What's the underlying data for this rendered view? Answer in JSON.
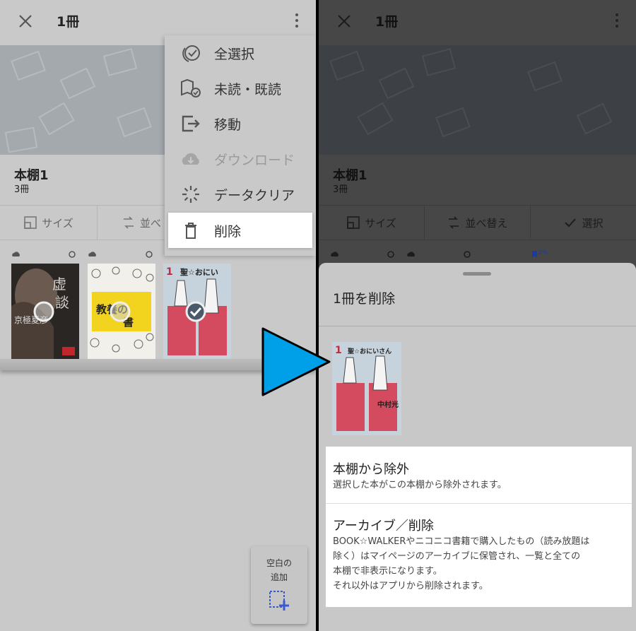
{
  "left": {
    "header": {
      "title": "1冊"
    },
    "shelf": {
      "name": "本棚1",
      "count": "3冊"
    },
    "toolbar": {
      "size_label": "サイズ",
      "sort_label": "並べ"
    },
    "menu": {
      "items": [
        {
          "label": "全選択",
          "icon": "select-all-icon"
        },
        {
          "label": "未読・既読",
          "icon": "read-status-icon"
        },
        {
          "label": "移動",
          "icon": "move-icon"
        },
        {
          "label": "ダウンロード",
          "icon": "cloud-download-icon",
          "disabled": true
        },
        {
          "label": "データクリア",
          "icon": "data-clear-icon"
        },
        {
          "label": "削除",
          "icon": "trash-icon",
          "highlighted": true
        }
      ]
    },
    "books": [
      {
        "cover_text_top": "虚談",
        "cover_text_bottom": "京極夏彦",
        "selected": false
      },
      {
        "cover_text_top": "教養の教科書",
        "selected": false
      },
      {
        "cover_text_top": "聖☆おにいさん",
        "selected": true
      }
    ],
    "add_blank": {
      "label": "空白の\n追加"
    }
  },
  "right": {
    "header": {
      "title": "1冊"
    },
    "shelf": {
      "name": "本棚1",
      "count": "3冊"
    },
    "toolbar": {
      "size_label": "サイズ",
      "sort_label": "並べ替え",
      "select_label": "選択"
    },
    "progress_badge": "3%",
    "sheet": {
      "title": "1冊を削除",
      "options": [
        {
          "title": "本棚から除外",
          "description": "選択した本がこの本棚から除外されます。"
        },
        {
          "title": "アーカイブ／削除",
          "description": "BOOK☆WALKERやニコニコ書籍で購入したもの（読み放題は\n除く）はマイページのアーカイブに保管され、一覧と全ての\n本棚で非表示になります。\nそれ以外はアプリから削除されます。"
        }
      ]
    }
  },
  "colors": {
    "arrow": "#00a0e9",
    "highlight": "#ffffff",
    "badge": "#1a3aa8"
  }
}
